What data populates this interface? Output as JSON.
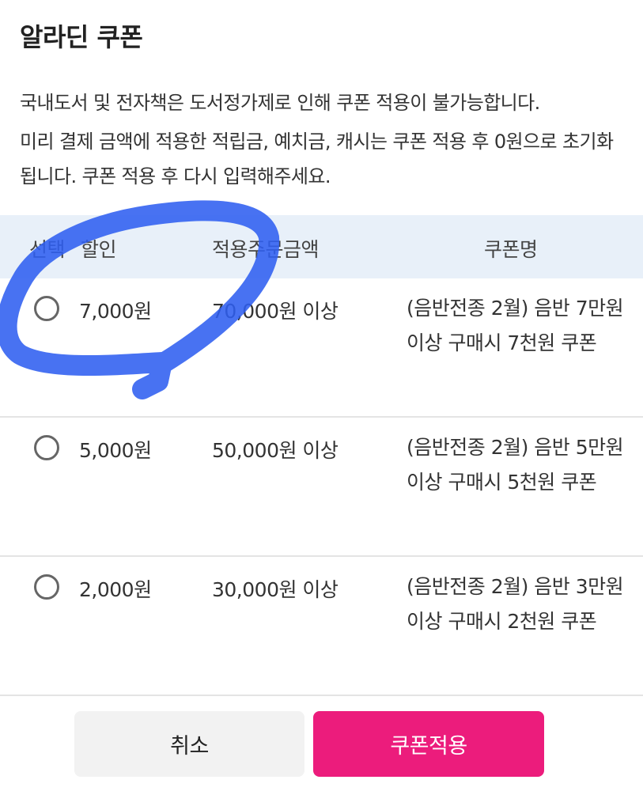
{
  "dialog": {
    "title": "알라딘 쿠폰",
    "notice_1": "국내도서 및 전자책은 도서정가제로 인해 쿠폰 적용이 불가능합니다.",
    "notice_2": "미리 결제 금액에 적용한 적립금, 예치금, 캐시는 쿠폰 적용 후 0원으로 초기화됩니다. 쿠폰 적용 후 다시 입력해주세요."
  },
  "table": {
    "headers": {
      "select": "선택",
      "discount": "할인",
      "minimum": "적용주문금액",
      "name": "쿠폰명"
    },
    "rows": [
      {
        "selected": false,
        "discount": "7,000원",
        "minimum": "70,000원 이상",
        "name": "(음반전종 2월) 음반 7만원 이상 구매시 7천원 쿠폰"
      },
      {
        "selected": false,
        "discount": "5,000원",
        "minimum": "50,000원 이상",
        "name": "(음반전종 2월) 음반 5만원 이상 구매시 5천원 쿠폰"
      },
      {
        "selected": false,
        "discount": "2,000원",
        "minimum": "30,000원 이상",
        "name": "(음반전종 2월) 음반 3만원 이상 구매시 2천원 쿠폰"
      }
    ]
  },
  "buttons": {
    "cancel": "취소",
    "apply": "쿠폰적용"
  },
  "colors": {
    "accent": "#ec1c7c",
    "header_bg": "#e8f0f9",
    "annotation_stroke": "#2f5ef0"
  }
}
